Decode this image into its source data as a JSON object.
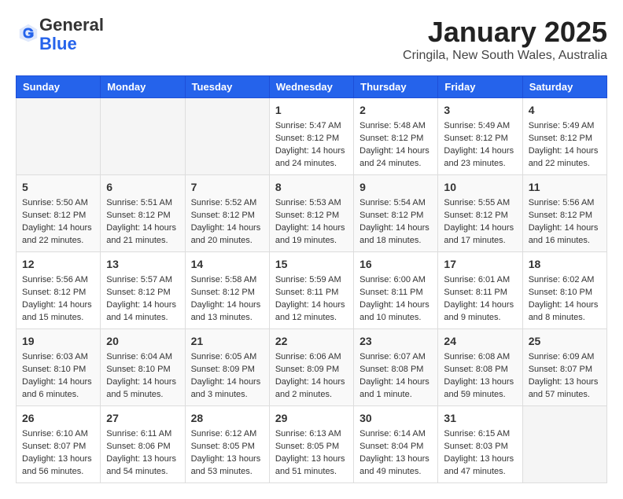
{
  "header": {
    "logo_general": "General",
    "logo_blue": "Blue",
    "month_title": "January 2025",
    "location": "Cringila, New South Wales, Australia"
  },
  "days_of_week": [
    "Sunday",
    "Monday",
    "Tuesday",
    "Wednesday",
    "Thursday",
    "Friday",
    "Saturday"
  ],
  "weeks": [
    [
      {
        "day": "",
        "content": ""
      },
      {
        "day": "",
        "content": ""
      },
      {
        "day": "",
        "content": ""
      },
      {
        "day": "1",
        "content": "Sunrise: 5:47 AM\nSunset: 8:12 PM\nDaylight: 14 hours\nand 24 minutes."
      },
      {
        "day": "2",
        "content": "Sunrise: 5:48 AM\nSunset: 8:12 PM\nDaylight: 14 hours\nand 24 minutes."
      },
      {
        "day": "3",
        "content": "Sunrise: 5:49 AM\nSunset: 8:12 PM\nDaylight: 14 hours\nand 23 minutes."
      },
      {
        "day": "4",
        "content": "Sunrise: 5:49 AM\nSunset: 8:12 PM\nDaylight: 14 hours\nand 22 minutes."
      }
    ],
    [
      {
        "day": "5",
        "content": "Sunrise: 5:50 AM\nSunset: 8:12 PM\nDaylight: 14 hours\nand 22 minutes."
      },
      {
        "day": "6",
        "content": "Sunrise: 5:51 AM\nSunset: 8:12 PM\nDaylight: 14 hours\nand 21 minutes."
      },
      {
        "day": "7",
        "content": "Sunrise: 5:52 AM\nSunset: 8:12 PM\nDaylight: 14 hours\nand 20 minutes."
      },
      {
        "day": "8",
        "content": "Sunrise: 5:53 AM\nSunset: 8:12 PM\nDaylight: 14 hours\nand 19 minutes."
      },
      {
        "day": "9",
        "content": "Sunrise: 5:54 AM\nSunset: 8:12 PM\nDaylight: 14 hours\nand 18 minutes."
      },
      {
        "day": "10",
        "content": "Sunrise: 5:55 AM\nSunset: 8:12 PM\nDaylight: 14 hours\nand 17 minutes."
      },
      {
        "day": "11",
        "content": "Sunrise: 5:56 AM\nSunset: 8:12 PM\nDaylight: 14 hours\nand 16 minutes."
      }
    ],
    [
      {
        "day": "12",
        "content": "Sunrise: 5:56 AM\nSunset: 8:12 PM\nDaylight: 14 hours\nand 15 minutes."
      },
      {
        "day": "13",
        "content": "Sunrise: 5:57 AM\nSunset: 8:12 PM\nDaylight: 14 hours\nand 14 minutes."
      },
      {
        "day": "14",
        "content": "Sunrise: 5:58 AM\nSunset: 8:12 PM\nDaylight: 14 hours\nand 13 minutes."
      },
      {
        "day": "15",
        "content": "Sunrise: 5:59 AM\nSunset: 8:11 PM\nDaylight: 14 hours\nand 12 minutes."
      },
      {
        "day": "16",
        "content": "Sunrise: 6:00 AM\nSunset: 8:11 PM\nDaylight: 14 hours\nand 10 minutes."
      },
      {
        "day": "17",
        "content": "Sunrise: 6:01 AM\nSunset: 8:11 PM\nDaylight: 14 hours\nand 9 minutes."
      },
      {
        "day": "18",
        "content": "Sunrise: 6:02 AM\nSunset: 8:10 PM\nDaylight: 14 hours\nand 8 minutes."
      }
    ],
    [
      {
        "day": "19",
        "content": "Sunrise: 6:03 AM\nSunset: 8:10 PM\nDaylight: 14 hours\nand 6 minutes."
      },
      {
        "day": "20",
        "content": "Sunrise: 6:04 AM\nSunset: 8:10 PM\nDaylight: 14 hours\nand 5 minutes."
      },
      {
        "day": "21",
        "content": "Sunrise: 6:05 AM\nSunset: 8:09 PM\nDaylight: 14 hours\nand 3 minutes."
      },
      {
        "day": "22",
        "content": "Sunrise: 6:06 AM\nSunset: 8:09 PM\nDaylight: 14 hours\nand 2 minutes."
      },
      {
        "day": "23",
        "content": "Sunrise: 6:07 AM\nSunset: 8:08 PM\nDaylight: 14 hours\nand 1 minute."
      },
      {
        "day": "24",
        "content": "Sunrise: 6:08 AM\nSunset: 8:08 PM\nDaylight: 13 hours\nand 59 minutes."
      },
      {
        "day": "25",
        "content": "Sunrise: 6:09 AM\nSunset: 8:07 PM\nDaylight: 13 hours\nand 57 minutes."
      }
    ],
    [
      {
        "day": "26",
        "content": "Sunrise: 6:10 AM\nSunset: 8:07 PM\nDaylight: 13 hours\nand 56 minutes."
      },
      {
        "day": "27",
        "content": "Sunrise: 6:11 AM\nSunset: 8:06 PM\nDaylight: 13 hours\nand 54 minutes."
      },
      {
        "day": "28",
        "content": "Sunrise: 6:12 AM\nSunset: 8:05 PM\nDaylight: 13 hours\nand 53 minutes."
      },
      {
        "day": "29",
        "content": "Sunrise: 6:13 AM\nSunset: 8:05 PM\nDaylight: 13 hours\nand 51 minutes."
      },
      {
        "day": "30",
        "content": "Sunrise: 6:14 AM\nSunset: 8:04 PM\nDaylight: 13 hours\nand 49 minutes."
      },
      {
        "day": "31",
        "content": "Sunrise: 6:15 AM\nSunset: 8:03 PM\nDaylight: 13 hours\nand 47 minutes."
      },
      {
        "day": "",
        "content": ""
      }
    ]
  ]
}
